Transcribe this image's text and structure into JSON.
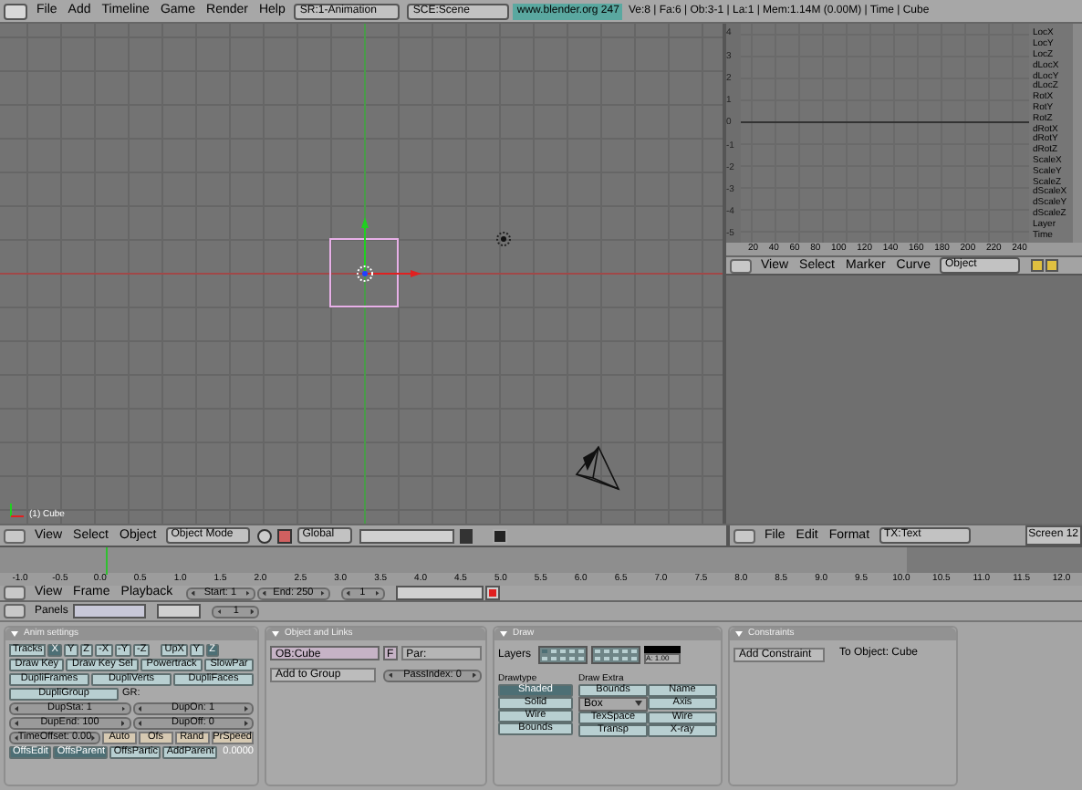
{
  "menu_bar": {
    "menus": [
      "File",
      "Add",
      "Timeline",
      "Game",
      "Render",
      "Help"
    ],
    "screen": "SR:1-Animation",
    "scene": "SCE:Scene",
    "link": "www.blender.org 247",
    "stats": "Ve:8 | Fa:6 | Ob:3-1 | La:1 | Mem:1.14M (0.00M) | Time | Cube"
  },
  "viewport": {
    "label": "(1) Cube",
    "header": {
      "menus": [
        "View",
        "Select",
        "Object"
      ],
      "mode": "Object Mode",
      "orientation": "Global"
    }
  },
  "ipo": {
    "yticks": [
      "4",
      "3",
      "2",
      "1",
      "0",
      "-1",
      "-2",
      "-3",
      "-4",
      "-5"
    ],
    "xticks": [
      "20",
      "40",
      "60",
      "80",
      "100",
      "120",
      "140",
      "160",
      "180",
      "200",
      "220",
      "240"
    ],
    "channels": [
      "LocX",
      "LocY",
      "LocZ",
      "dLocX",
      "dLocY",
      "dLocZ",
      "RotX",
      "RotY",
      "RotZ",
      "dRotX",
      "dRotY",
      "dRotZ",
      "ScaleX",
      "ScaleY",
      "ScaleZ",
      "dScaleX",
      "dScaleY",
      "dScaleZ",
      "Layer",
      "Time"
    ],
    "header": {
      "menus": [
        "View",
        "Select",
        "Marker",
        "Curve"
      ],
      "type": "Object"
    }
  },
  "text_editor": {
    "header": {
      "menus": [
        "File",
        "Edit",
        "Format"
      ],
      "text": "TX:Text",
      "screen": "Screen 12"
    }
  },
  "timeline": {
    "ruler": [
      "-1.0",
      "-0.5",
      "0.0",
      "0.5",
      "1.0",
      "1.5",
      "2.0",
      "2.5",
      "3.0",
      "3.5",
      "4.0",
      "4.5",
      "5.0",
      "5.5",
      "6.0",
      "6.5",
      "7.0",
      "7.5",
      "8.0",
      "8.5",
      "9.0",
      "9.5",
      "10.0",
      "10.5",
      "11.0",
      "11.5",
      "12.0"
    ],
    "header": {
      "menus": [
        "View",
        "Frame",
        "Playback"
      ],
      "start": "Start: 1",
      "end": "End: 250",
      "frame": "1"
    }
  },
  "buttons": {
    "header": {
      "label": "Panels",
      "page": "1"
    },
    "anim_settings": {
      "title": "Anim settings",
      "tracks": {
        "label": "Tracks",
        "options": [
          {
            "label": "X",
            "selected": true
          },
          {
            "label": "Y",
            "selected": false
          },
          {
            "label": "Z",
            "selected": false
          },
          {
            "label": "-X",
            "selected": false
          },
          {
            "label": "-Y",
            "selected": false
          },
          {
            "label": "-Z",
            "selected": false
          }
        ]
      },
      "up": {
        "options": [
          {
            "label": "UpX",
            "selected": false
          },
          {
            "label": "Y",
            "selected": false
          },
          {
            "label": "Z",
            "selected": true
          }
        ]
      },
      "draw_buttons": [
        "Draw Key",
        "Draw Key Sel",
        "Powertrack",
        "SlowPar"
      ],
      "dupli_buttons": [
        "DupliFrames",
        "DupliVerts",
        "DupliFaces"
      ],
      "dupli_group": "DupliGroup",
      "group_field": "GR:",
      "numbers": [
        [
          "DupSta: 1",
          "DupOn: 1"
        ],
        [
          "DupEnd: 100",
          "DupOff: 0"
        ]
      ],
      "time_offset": "TimeOffset: 0.00",
      "offset_toggles": [
        "Auto",
        "Ofs",
        "Rand",
        "PrSpeed"
      ],
      "offs_options": [
        {
          "label": "OffsEdit",
          "selected": true
        },
        {
          "label": "OffsParent",
          "selected": true
        },
        {
          "label": "OffsPartic",
          "selected": false
        },
        {
          "label": "AddParent",
          "selected": false
        }
      ],
      "value": "0.0000"
    },
    "object_links": {
      "title": "Object and Links",
      "object": "OB:Cube",
      "object_menu": "F",
      "parent": "Par:",
      "add_group": "Add to Group",
      "pass_index": "PassIndex: 0"
    },
    "draw": {
      "title": "Draw",
      "layers_label": "Layers",
      "layers": [
        {
          "selected": true
        },
        {
          "selected": false
        },
        {
          "selected": false
        },
        {
          "selected": false
        },
        {
          "selected": false
        },
        {
          "selected": false
        },
        {
          "selected": false
        },
        {
          "selected": false
        },
        {
          "selected": false
        },
        {
          "selected": false
        },
        {
          "selected": false
        },
        {
          "selected": false
        },
        {
          "selected": false
        },
        {
          "selected": false
        },
        {
          "selected": false
        },
        {
          "selected": false
        },
        {
          "selected": false
        },
        {
          "selected": false
        },
        {
          "selected": false
        },
        {
          "selected": false
        }
      ],
      "alpha": "A: 1.00",
      "drawtype_label": "Drawtype",
      "drawtype": [
        {
          "label": "Shaded",
          "selected": true
        },
        {
          "label": "Solid",
          "selected": false
        },
        {
          "label": "Wire",
          "selected": false
        },
        {
          "label": "Bounds",
          "selected": false
        }
      ],
      "extra_label": "Draw Extra",
      "extra": [
        {
          "kind": "toggle",
          "label": "Bounds"
        },
        {
          "kind": "toggle",
          "label": "Name"
        },
        {
          "kind": "dropdown",
          "label": "Box"
        },
        {
          "kind": "toggle",
          "label": "Axis"
        },
        {
          "kind": "toggle",
          "label": "TexSpace"
        },
        {
          "kind": "toggle",
          "label": "Wire"
        },
        {
          "kind": "toggle",
          "label": "Transp"
        },
        {
          "kind": "toggle",
          "label": "X-ray"
        }
      ]
    },
    "constraints": {
      "title": "Constraints",
      "add": "Add Constraint",
      "target": "To Object: Cube"
    }
  }
}
